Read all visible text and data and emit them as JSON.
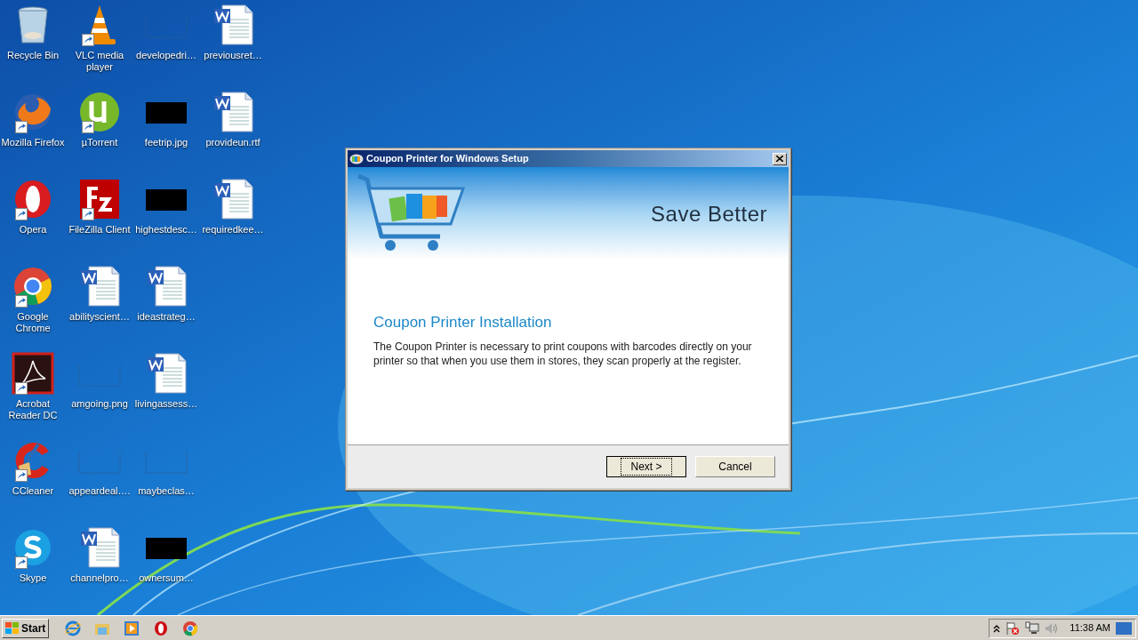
{
  "desktop_icons": [
    {
      "label": "Recycle Bin",
      "kind": "recycle",
      "shortcut": false
    },
    {
      "label": "Mozilla Firefox",
      "kind": "firefox",
      "shortcut": true
    },
    {
      "label": "Opera",
      "kind": "opera",
      "shortcut": true
    },
    {
      "label": "Google Chrome",
      "kind": "chrome",
      "shortcut": true
    },
    {
      "label": "Acrobat Reader DC",
      "kind": "acrobat",
      "shortcut": true
    },
    {
      "label": "CCleaner",
      "kind": "ccleaner",
      "shortcut": true
    },
    {
      "label": "Skype",
      "kind": "skype",
      "shortcut": true
    },
    {
      "label": "VLC media player",
      "kind": "vlc",
      "shortcut": true
    },
    {
      "label": "µTorrent",
      "kind": "utorrent",
      "shortcut": true
    },
    {
      "label": "FileZilla Client",
      "kind": "filezilla",
      "shortcut": true
    },
    {
      "label": "abilityscient…",
      "kind": "word",
      "shortcut": false
    },
    {
      "label": "amgoing.png",
      "kind": "blank",
      "shortcut": false
    },
    {
      "label": "appeardeal….",
      "kind": "blank",
      "shortcut": false
    },
    {
      "label": "channelpro…",
      "kind": "word",
      "shortcut": false
    },
    {
      "label": "developedri…",
      "kind": "blank",
      "shortcut": false
    },
    {
      "label": "feetrip.jpg",
      "kind": "black",
      "shortcut": false
    },
    {
      "label": "highestdesc…",
      "kind": "black",
      "shortcut": false
    },
    {
      "label": "ideastrateg…",
      "kind": "word",
      "shortcut": false
    },
    {
      "label": "livingassess…",
      "kind": "word",
      "shortcut": false
    },
    {
      "label": "maybeclas…",
      "kind": "blank",
      "shortcut": false
    },
    {
      "label": "ownersum…",
      "kind": "black",
      "shortcut": false
    },
    {
      "label": "previousret…",
      "kind": "word",
      "shortcut": false
    },
    {
      "label": "provideun.rtf",
      "kind": "word",
      "shortcut": false
    },
    {
      "label": "requiredkee…",
      "kind": "word",
      "shortcut": false
    }
  ],
  "dialog": {
    "title": "Coupon Printer for Windows Setup",
    "slogan": "Save Better",
    "heading": "Coupon Printer Installation",
    "body": "The Coupon Printer is necessary to print coupons with barcodes directly on your printer so that when you use them in stores, they scan properly at the register.",
    "buttons": [
      {
        "label": "Next >",
        "focused": true
      },
      {
        "label": "Cancel",
        "focused": false
      }
    ]
  },
  "taskbar": {
    "start": "Start",
    "quick_launch": [
      {
        "kind": "ie"
      },
      {
        "kind": "explorer"
      },
      {
        "kind": "media"
      },
      {
        "kind": "opera"
      },
      {
        "kind": "chrome"
      }
    ],
    "clock": "11:38 AM"
  }
}
